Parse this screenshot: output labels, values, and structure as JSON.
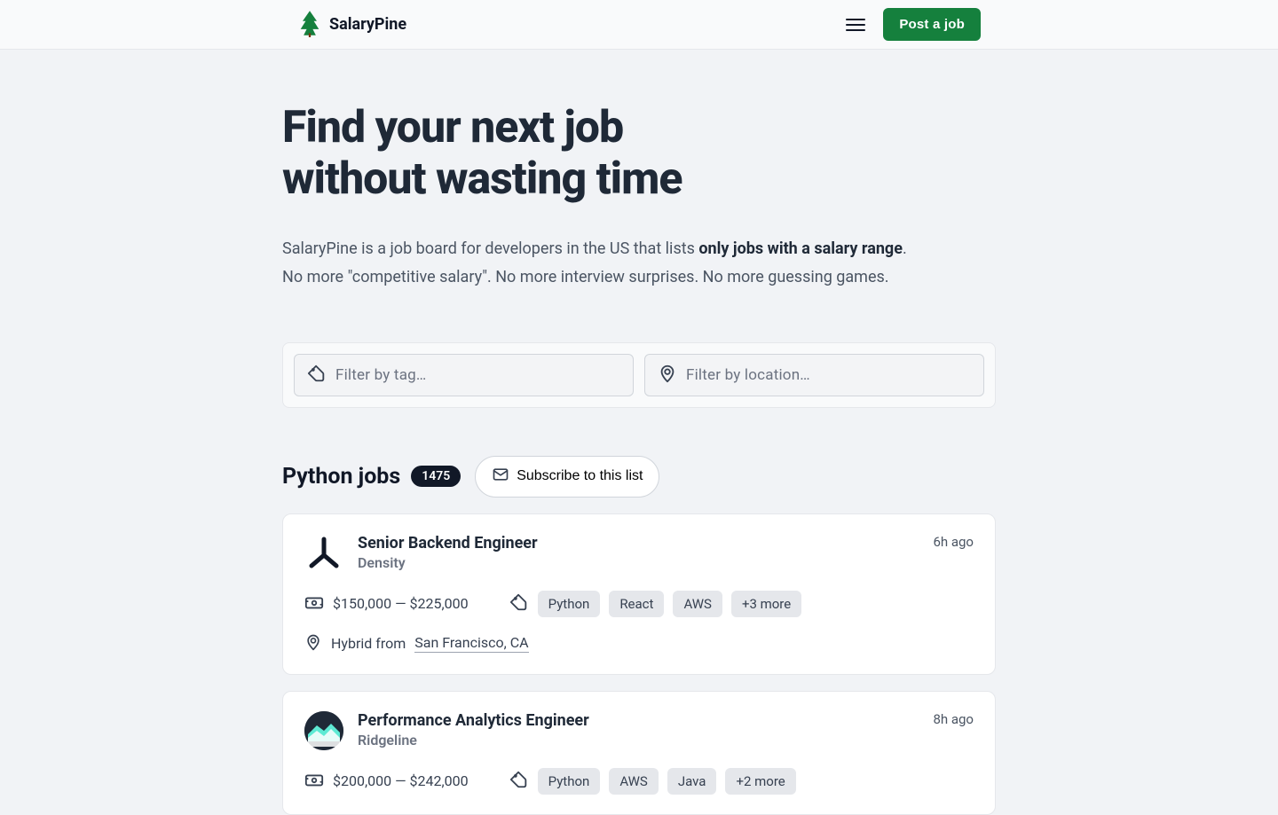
{
  "brand": {
    "name": "SalaryPine"
  },
  "header": {
    "post_job_label": "Post a job"
  },
  "hero": {
    "title_line1": "Find your next job",
    "title_line2": "without wasting time",
    "desc_prefix": "SalaryPine is a job board for developers in the US that lists ",
    "desc_bold": "only jobs with a salary range",
    "desc_suffix1": ".",
    "desc_line2": "No more \"competitive salary\". No more interview surprises. No more guessing games."
  },
  "filters": {
    "tag_placeholder": "Filter by tag…",
    "location_placeholder": "Filter by location…"
  },
  "list": {
    "title": "Python jobs",
    "count": "1475",
    "subscribe_label": "Subscribe to this list"
  },
  "jobs": [
    {
      "title": "Senior Backend Engineer",
      "company": "Density",
      "posted": "6h ago",
      "salary": "$150,000 — $225,000",
      "tags": [
        "Python",
        "React",
        "AWS"
      ],
      "more_tags": "+3 more",
      "location_prefix": "Hybrid from",
      "location": "San Francisco, CA"
    },
    {
      "title": "Performance Analytics Engineer",
      "company": "Ridgeline",
      "posted": "8h ago",
      "salary": "$200,000 — $242,000",
      "tags": [
        "Python",
        "AWS",
        "Java"
      ],
      "more_tags": "+2 more"
    }
  ]
}
